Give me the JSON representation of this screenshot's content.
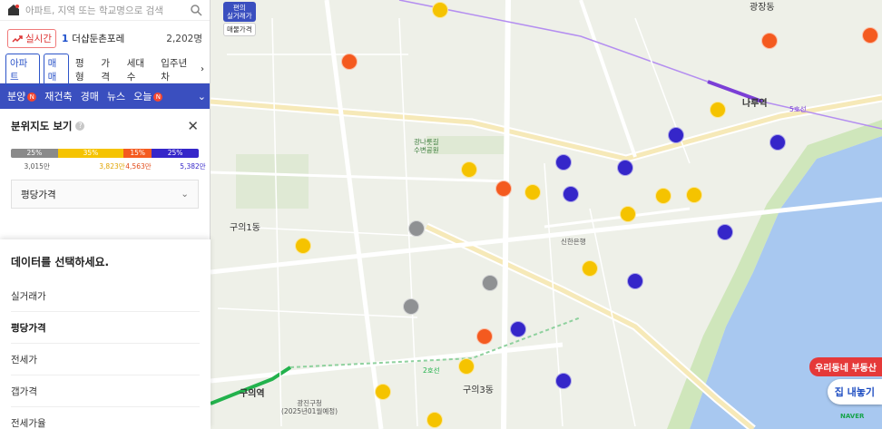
{
  "search": {
    "placeholder": "아파트, 지역 또는 학교명으로 검색"
  },
  "realtime": {
    "button_label": "실시간",
    "rank": "1",
    "name": "더샵둔촌포레",
    "count": "2,202명"
  },
  "filters": {
    "items": [
      "아파트",
      "매매",
      "평형",
      "가격",
      "세대수",
      "입주년차"
    ]
  },
  "tabs": {
    "items": [
      "분양",
      "재건축",
      "경매",
      "뉴스",
      "오늘"
    ],
    "badge": "N"
  },
  "distribution": {
    "title": "분위지도 보기",
    "segments": [
      {
        "label": "25%",
        "color": "#8a8a8a",
        "share": 25
      },
      {
        "label": "35%",
        "color": "#f5c300",
        "share": 35
      },
      {
        "label": "15%",
        "color": "#f45a1f",
        "share": 15
      },
      {
        "label": "25%",
        "color": "#3526c9",
        "share": 25
      }
    ],
    "ticks": [
      {
        "label": "3,015만",
        "color": "#555555"
      },
      {
        "label": "3,823만",
        "color": "#e0a400"
      },
      {
        "label": "4,563만",
        "color": "#e24a18"
      },
      {
        "label": "5,382만",
        "color": "#3526c9"
      }
    ],
    "select_value": "평당가격"
  },
  "dropdown": {
    "title": "데이터를 선택하세요.",
    "options": [
      "실거래가",
      "평당가격",
      "전세가",
      "갭가격",
      "전세가율"
    ],
    "selected": "평당가격"
  },
  "map": {
    "type_chip": "편의\n실거래가",
    "price_chip": "매물가격",
    "labels": {
      "dong1": "구의1동",
      "dong3": "구의3동",
      "gwangjang": "광장동",
      "station_guui": "구의역",
      "station_naru": "나루역",
      "park": "광나룻길\n수변공원",
      "bank": "신한은행",
      "line2": "2호선",
      "line5": "5호선",
      "jgs": "광진구청\n(2025년01월예정)"
    },
    "pin_colors": {
      "gray": "#8f9193",
      "yellow": "#f5c300",
      "orange": "#f45a1f",
      "blue": "#3526c9"
    },
    "right_button": "우리동네 부동산",
    "right_button2": "집 내놓기",
    "attribution": "NAVER"
  }
}
